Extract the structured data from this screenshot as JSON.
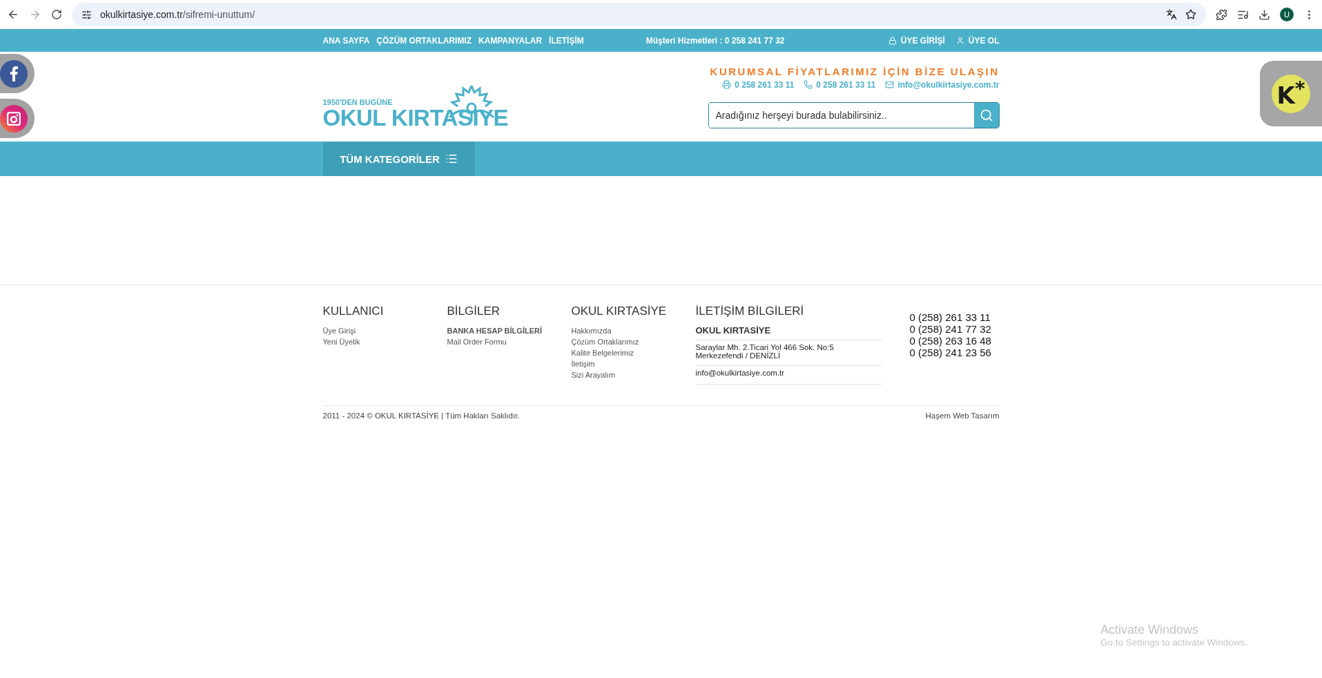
{
  "browser": {
    "url_host": "okulkirtasiye.com.tr",
    "url_path": "/sifremi-unuttum/",
    "profile_initial": "U"
  },
  "top_bar": {
    "links": [
      {
        "label": "ANA SAYFA"
      },
      {
        "label": "ÇÖZÜM ORTAKLARIMIZ"
      },
      {
        "label": "KAMPANYALAR"
      },
      {
        "label": "İLETİŞİM"
      }
    ],
    "hotline": "Müşteri Hizmetleri : 0 258 241 77 32",
    "account_links": [
      {
        "kind": "login",
        "label": "ÜYE GİRİŞİ"
      },
      {
        "kind": "register",
        "label": "ÜYE OL"
      }
    ]
  },
  "header": {
    "logo": {
      "tagline": "1950'DEN BUGÜNE",
      "name": "OKUL KIRTASIYE"
    },
    "slogan": "KURUMSAL FİYATLARIMIZ İÇİN BİZE ULAŞIN",
    "contacts": [
      {
        "kind": "fax",
        "text": "0 258 261 33 11"
      },
      {
        "kind": "phone",
        "text": "0 258 261 33 11"
      },
      {
        "kind": "mail",
        "text": "info@okulkirtasiye.com.tr"
      }
    ],
    "search": {
      "placeholder": "Aradığınız herşeyi burada bulabilirsiniz.."
    }
  },
  "category_bar": {
    "button": "TÜM KATEGORİLER"
  },
  "social": [
    {
      "kind": "facebook"
    },
    {
      "kind": "instagram"
    }
  ],
  "side_badge": {
    "text": "K$^{*}$"
  },
  "footer": {
    "columns": [
      {
        "title": "KULLANICI",
        "links": [
          {
            "label": "Üye Girişi",
            "bold": false
          },
          {
            "label": "Yeni Üyelik",
            "bold": false
          }
        ]
      },
      {
        "title": "BİLGİLER",
        "links": [
          {
            "label": "BANKA HESAP BİLGİLERİ",
            "bold": true
          },
          {
            "label": "Mail Order Formu",
            "bold": false
          }
        ]
      },
      {
        "title": "OKUL KIRTASİYE",
        "links": [
          {
            "label": "Hakkımızda",
            "bold": false
          },
          {
            "label": "Çözüm Ortaklarımız",
            "bold": false
          },
          {
            "label": "Kalite Belgelerimiz",
            "bold": false
          },
          {
            "label": "İletişim",
            "bold": false
          },
          {
            "label": "Sizi Arayalım",
            "bold": false
          }
        ]
      }
    ],
    "contact": {
      "title": "İLETİŞİM BİLGİLERİ",
      "company": "OKUL KIRTASİYE",
      "address_lines": [
        "Saraylar Mh. 2.Ticari Yol 466 Sok. No:5",
        "Merkezefendi / DENİZLİ"
      ],
      "email": "info@okulkirtasiye.com.tr"
    },
    "phones": [
      "0 (258) 261 33 11",
      "0 (258) 241 77 32",
      "0 (258) 263 16 48",
      "0 (258) 241 23 56"
    ],
    "copyright": "2011 - 2024 © OKUL KIRTASİYE | Tüm Hakları Saklıdır.",
    "credit": "Haşem Web Tasarım"
  },
  "os_notice": {
    "title": "Activate Windows",
    "subtitle": "Go to Settings to activate Windows."
  }
}
